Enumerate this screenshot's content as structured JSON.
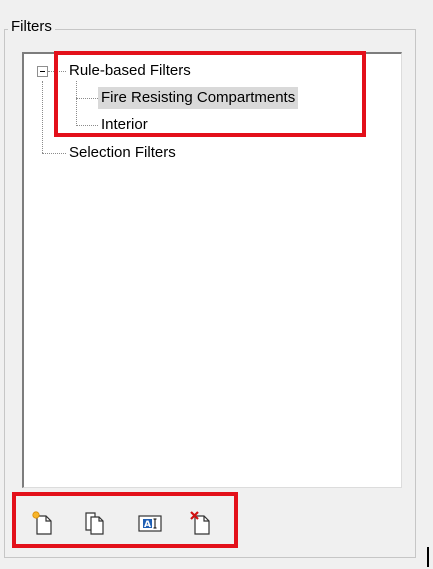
{
  "group": {
    "title": "Filters"
  },
  "tree": {
    "root_rule": "Rule-based Filters",
    "child_fire": "Fire Resisting Compartments",
    "child_interior": "Interior",
    "root_selection": "Selection Filters"
  },
  "toolbar": {
    "new_icon": "new-filter-icon",
    "duplicate_icon": "duplicate-filter-icon",
    "rename_icon": "rename-filter-icon",
    "delete_icon": "delete-filter-icon"
  },
  "colors": {
    "highlight": "#e3101a",
    "selected_bg": "#d9d9d9"
  }
}
